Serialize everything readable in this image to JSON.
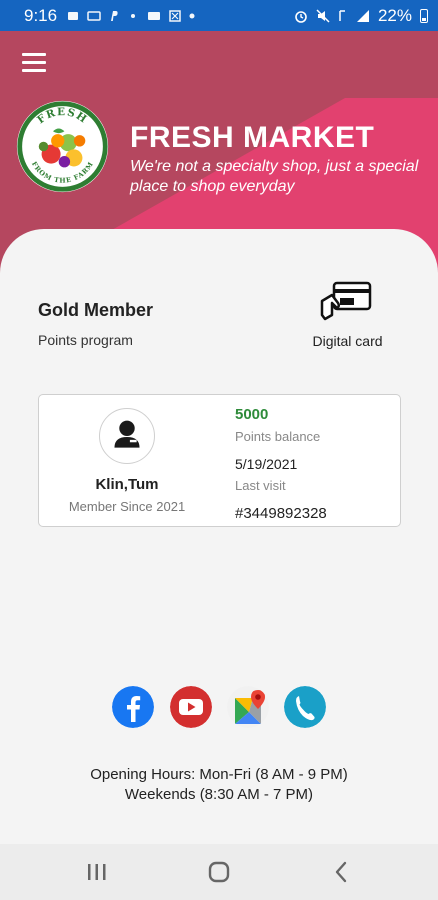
{
  "status_bar": {
    "time": "9:16",
    "battery_percent": "22%",
    "left_icons": [
      "notification-icon",
      "message-icon",
      "paypal-icon",
      "wifi-hotspot-icon",
      "voicemail-icon",
      "gallery-icon",
      "dot-icon"
    ],
    "right_icons": [
      "alarm-icon",
      "mute-icon",
      "wifi-icon",
      "signal-icon",
      "battery-icon"
    ]
  },
  "header": {
    "brand_name": "FRESH MARKET",
    "tagline": "We're not a specialty shop, just a special place to shop everyday",
    "logo_text_top": "FRESH",
    "logo_text_bottom": "FROM THE FARM",
    "colors": {
      "primary": "#b5475f",
      "accent": "#e2416f"
    }
  },
  "membership": {
    "level": "Gold Member",
    "program": "Points program",
    "digital_card_label": "Digital card"
  },
  "member_card": {
    "name": "Klin,Tum",
    "member_since": "Member Since 2021",
    "points_value": "5000",
    "points_label": "Points balance",
    "last_visit_date": "5/19/2021",
    "last_visit_label": "Last visit",
    "member_number": "#3449892328"
  },
  "social": [
    {
      "name": "facebook-icon",
      "color": "#1877f2"
    },
    {
      "name": "youtube-icon",
      "color": "#d32f2f"
    },
    {
      "name": "google-maps-icon",
      "color": "#34a853"
    },
    {
      "name": "phone-icon",
      "color": "#1aa0c8"
    }
  ],
  "footer": {
    "hours_line1": "Opening Hours: Mon-Fri (8 AM - 9 PM)",
    "hours_line2": "Weekends (8:30 AM - 7 PM)"
  },
  "nav_bar": {
    "buttons": [
      "recent-apps-icon",
      "home-icon",
      "back-icon"
    ]
  }
}
